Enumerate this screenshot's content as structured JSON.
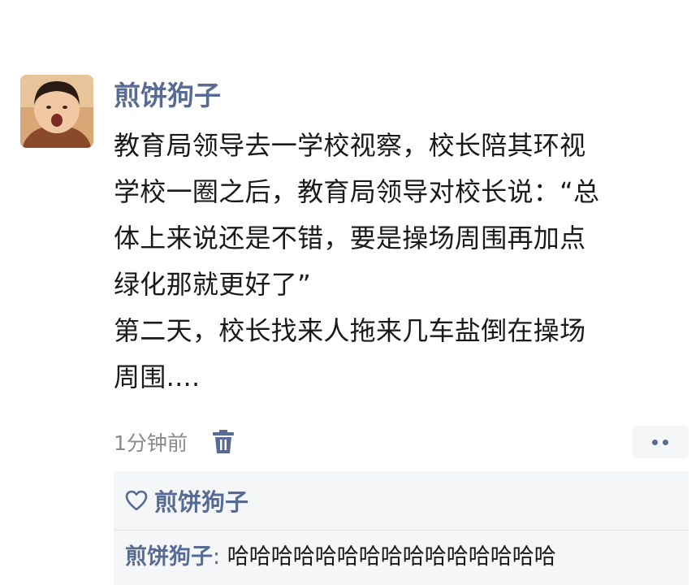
{
  "post": {
    "author": "煎饼狗子",
    "lines": [
      "教育局领导去一学校视察，校长陪其环视",
      "学校一圈之后，教育局领导对校长说：“总",
      "体上来说还是不错，要是操场周围再加点",
      "绿化那就更好了”",
      "第二天，校长找来人拖来几车盐倒在操场",
      "周围...."
    ],
    "timestamp": "1分钟前"
  },
  "likes": {
    "names": "煎饼狗子"
  },
  "comments": [
    {
      "author": "煎饼狗子",
      "separator": ":",
      "text": " 哈哈哈哈哈哈哈哈哈哈哈哈哈哈哈"
    }
  ],
  "colors": {
    "name_link": "#576b95",
    "body_text": "#1a1a1a",
    "muted": "#8a8a8a",
    "panel_bg": "#f5f6f8"
  },
  "icons": {
    "delete": "trash-icon",
    "more": "more-dots-icon",
    "like": "heart-outline-icon"
  }
}
